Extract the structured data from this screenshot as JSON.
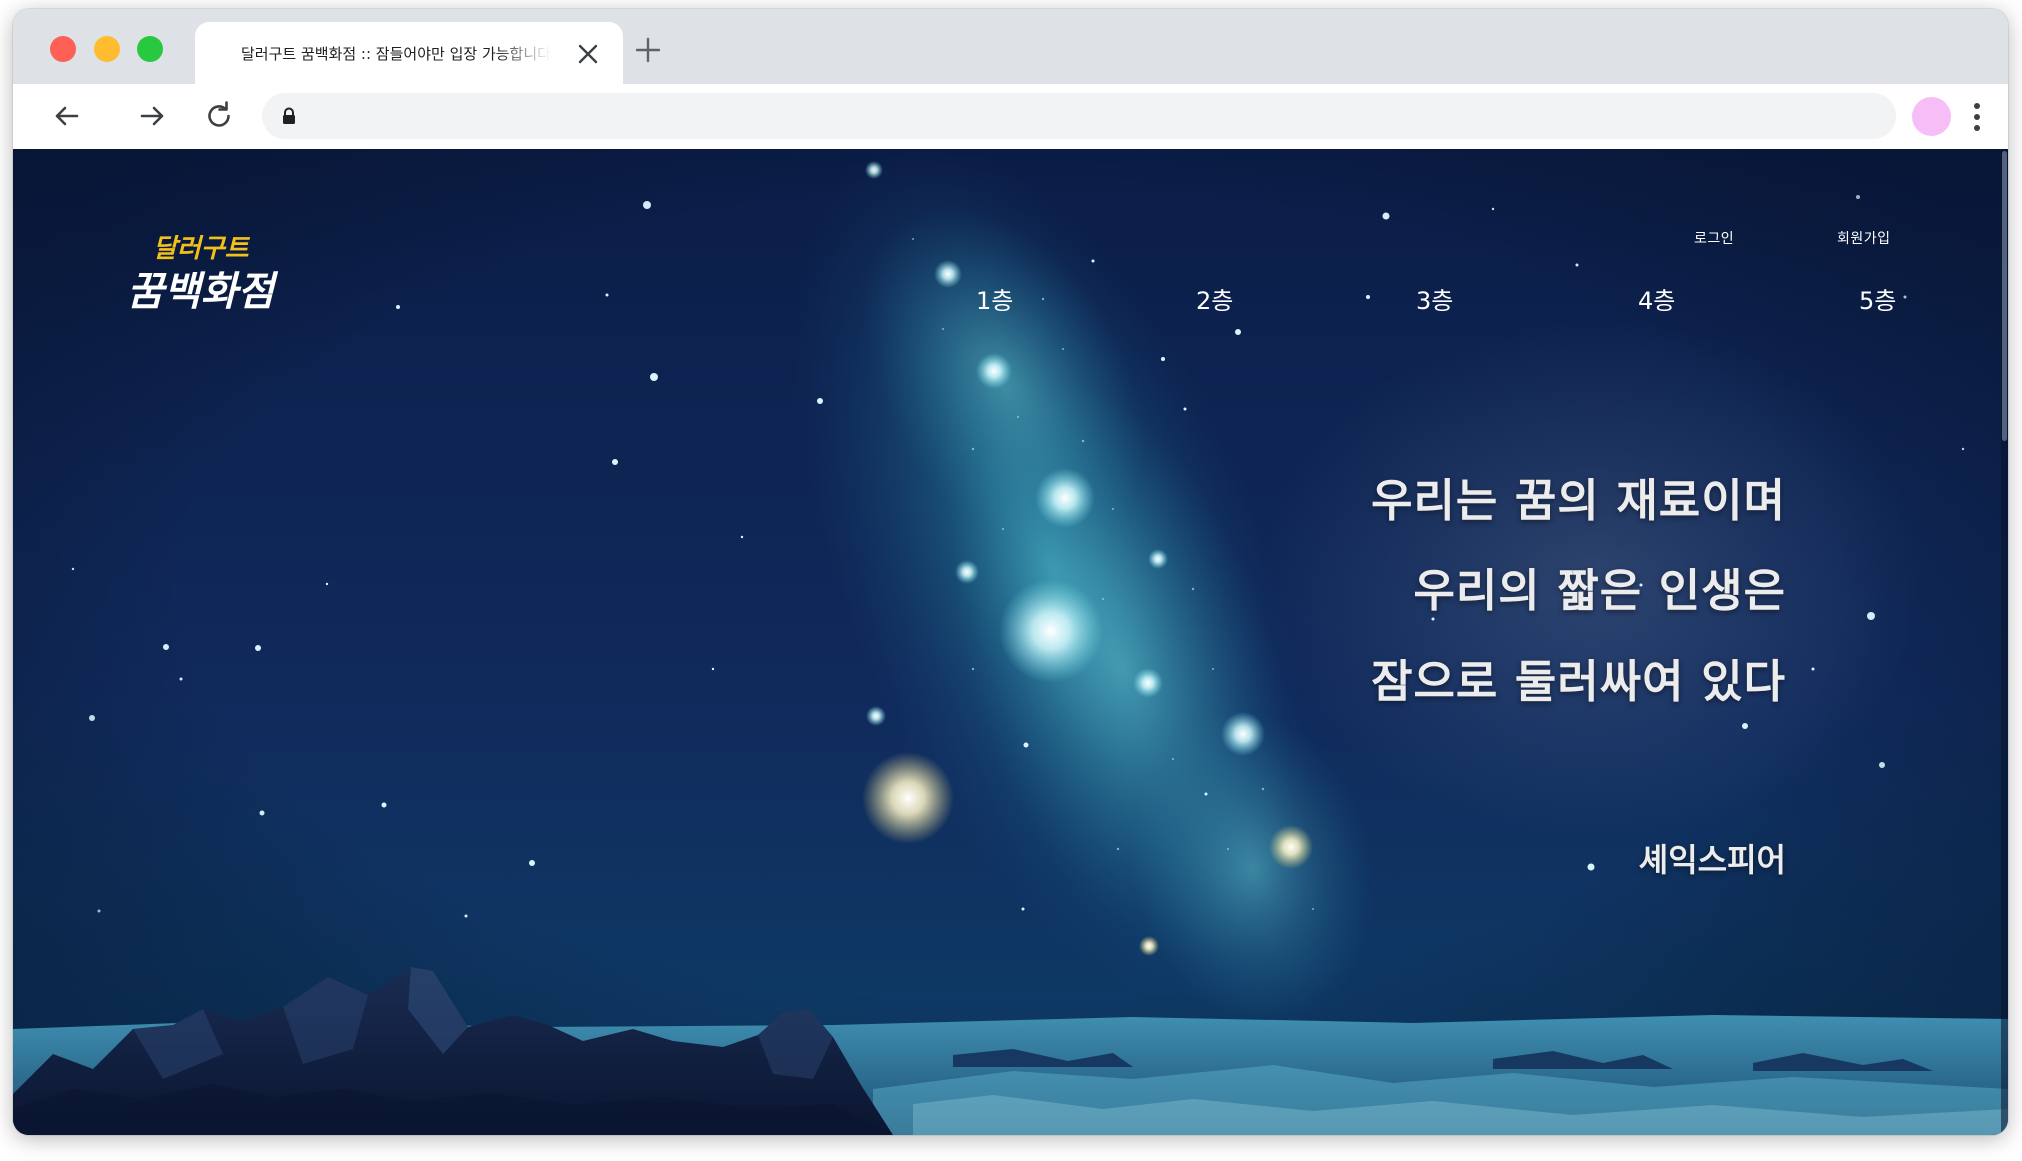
{
  "colors": {
    "traffic_close": "#fe5f57",
    "traffic_minimize": "#febc2e",
    "traffic_maximize": "#28c840",
    "profile_avatar": "#f7bdf6",
    "sky_top": "#0b1d47",
    "nebula": "#2fa3b8",
    "logo_top": "#f2c01b"
  },
  "browser": {
    "tab_title": "달러구트 꿈백화점 :: 잠들어야만 입장 가능합니다",
    "address": ""
  },
  "site": {
    "logo": {
      "line1": "달러구트",
      "line2": "꿈백화점"
    },
    "top_links": {
      "login": "로그인",
      "signup": "회원가입"
    },
    "floors": [
      "1층",
      "2층",
      "3층",
      "4층",
      "5층"
    ],
    "quote": {
      "lines": [
        "우리는 꿈의 재료이며",
        "우리의 짧은 인생은",
        "잠으로 둘러싸여 있다"
      ],
      "author": "셰익스피어"
    }
  }
}
